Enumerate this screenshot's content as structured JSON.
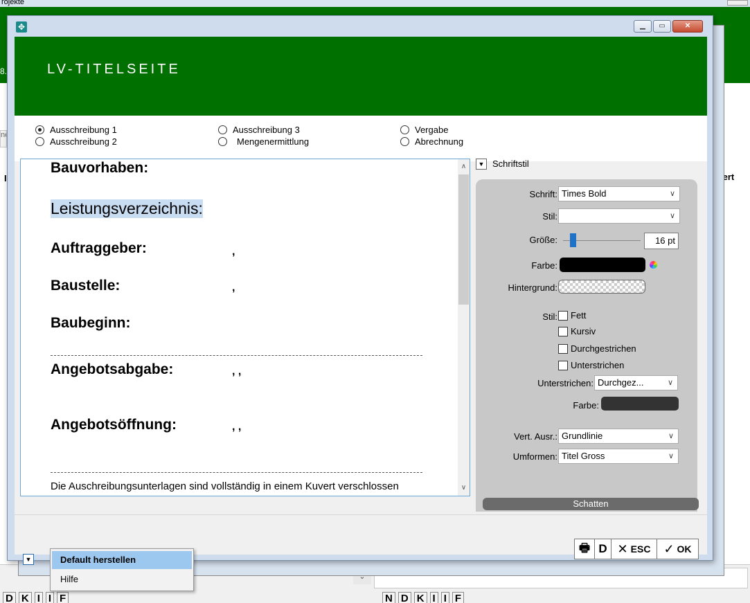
{
  "background": {
    "titlebar_text": "rojekte",
    "green_label": "8.",
    "left_strip_text": "ne",
    "left_header": "I",
    "right_header": "lert",
    "toolbar_left": [
      "D",
      "K",
      "I",
      "I",
      "F"
    ],
    "toolbar_right": [
      "N",
      "D",
      "K",
      "I",
      "I",
      "F"
    ]
  },
  "dialog": {
    "banner_title": "LV-TITELSEITE",
    "radios": [
      {
        "label": "Ausschreibung 1",
        "checked": true
      },
      {
        "label": "Ausschreibung 2",
        "checked": false
      },
      {
        "label": "Ausschreibung 3",
        "checked": false
      },
      {
        "label": "Mengenermittlung",
        "checked": false
      },
      {
        "label": "Vergabe",
        "checked": false
      },
      {
        "label": "Abrechnung",
        "checked": false
      }
    ],
    "editor": {
      "bauvorhaben": "Bauvorhaben:",
      "leistungsverzeichnis": "Leistungsverzeichnis:",
      "auftraggeber": "Auftraggeber:",
      "baustelle": "Baustelle:",
      "baubeginn": "Baubeginn:",
      "angebotsabgabe": "Angebotsabgabe:",
      "angebotsoeffnung": "Angebotsöffnung:",
      "comma_single": ",",
      "comma_double": ", ,",
      "footer_text": "Die Auschreibungsunterlagen sind vollständig in einem Kuvert verschlossen"
    },
    "panel": {
      "title": "Schriftstil",
      "schrift_label": "Schrift:",
      "schrift_value": "Times Bold",
      "stil_label": "Stil:",
      "stil_value": "",
      "groesse_label": "Größe:",
      "groesse_value": "16 pt",
      "farbe_label": "Farbe:",
      "farbe_color": "#000000",
      "hintergrund_label": "Hintergrund:",
      "stil2_label": "Stil:",
      "checkboxes": [
        "Fett",
        "Kursiv",
        "Durchgestrichen",
        "Unterstrichen"
      ],
      "unterstrichen_label": "Unterstrichen:",
      "unterstrichen_value": "Durchgez...",
      "farbe2_label": "Farbe:",
      "farbe2_color": "#333333",
      "vert_label": "Vert. Ausr.:",
      "vert_value": "Grundlinie",
      "umformen_label": "Umformen:",
      "umformen_value": "Titel Gross",
      "schatten_label": "Schatten"
    },
    "toolbar": {
      "print_label": "🖶",
      "d_label": "D",
      "x_label": "✕",
      "esc_label": "ESC",
      "check_label": "✓",
      "ok_label": "OK"
    }
  },
  "popup_menu": {
    "items": [
      "Default herstellen",
      "Hilfe"
    ]
  },
  "colors": {
    "banner_green": "#007000",
    "selection": "#c8dcf2",
    "menu_highlight": "#9cc8ef"
  }
}
